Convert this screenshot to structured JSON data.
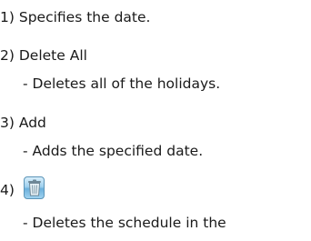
{
  "items": [
    {
      "number": "1)",
      "title": "Specifies the date."
    },
    {
      "number": "2)",
      "title": "Delete All",
      "description": "- Deletes all of the holidays."
    },
    {
      "number": "3)",
      "title": "Add",
      "description": "- Adds the specified date."
    },
    {
      "number": "4)",
      "icon": "trash-icon",
      "description": "- Deletes the schedule in the"
    }
  ],
  "colors": {
    "text": "#1a1a1a",
    "icon_border": "#5c95b8",
    "icon_fill": "#9fd0ee"
  }
}
